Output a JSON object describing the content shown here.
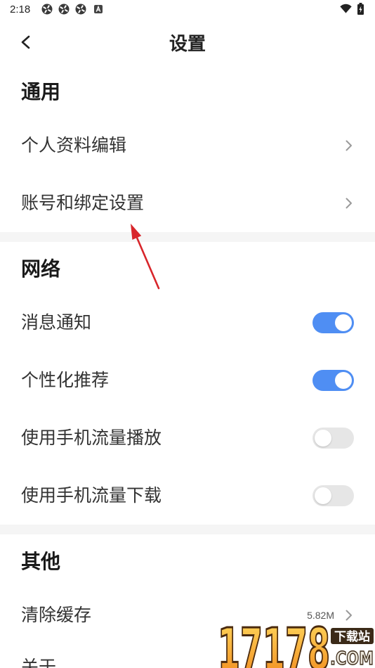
{
  "status_bar": {
    "time": "2:18",
    "left_icons": [
      "app-badge-icon",
      "app-badge-icon",
      "app-badge-icon",
      "a-box-icon"
    ],
    "right_icons": [
      "wifi-icon",
      "battery-charging-icon"
    ]
  },
  "header": {
    "back_icon": "chevron-left-icon",
    "title": "设置"
  },
  "sections": [
    {
      "title": "通用",
      "items": [
        {
          "label": "个人资料编辑",
          "icon": "chevron-right-icon"
        },
        {
          "label": "账号和绑定设置",
          "icon": "chevron-right-icon"
        }
      ]
    },
    {
      "title": "网络",
      "items": [
        {
          "label": "消息通知",
          "toggle_on": true
        },
        {
          "label": "个性化推荐",
          "toggle_on": true
        },
        {
          "label": "使用手机流量播放",
          "toggle_on": false
        },
        {
          "label": "使用手机流量下载",
          "toggle_on": false
        }
      ]
    },
    {
      "title": "其他",
      "items": [
        {
          "label": "清除缓存",
          "value": "5.82M",
          "icon": "chevron-right-icon"
        },
        {
          "label": "关于"
        }
      ]
    }
  ],
  "annotation": {
    "icon": "red-arrow-icon",
    "color": "#d8262b"
  },
  "watermark": {
    "digits": "17178",
    "tag": "下载站",
    "domain": ".COM"
  },
  "colors": {
    "accent": "#4f8ef3",
    "toggle_off": "#e6e6e6",
    "divider": "#f5f5f5",
    "text": "#333333",
    "heading": "#1a1a1a"
  }
}
